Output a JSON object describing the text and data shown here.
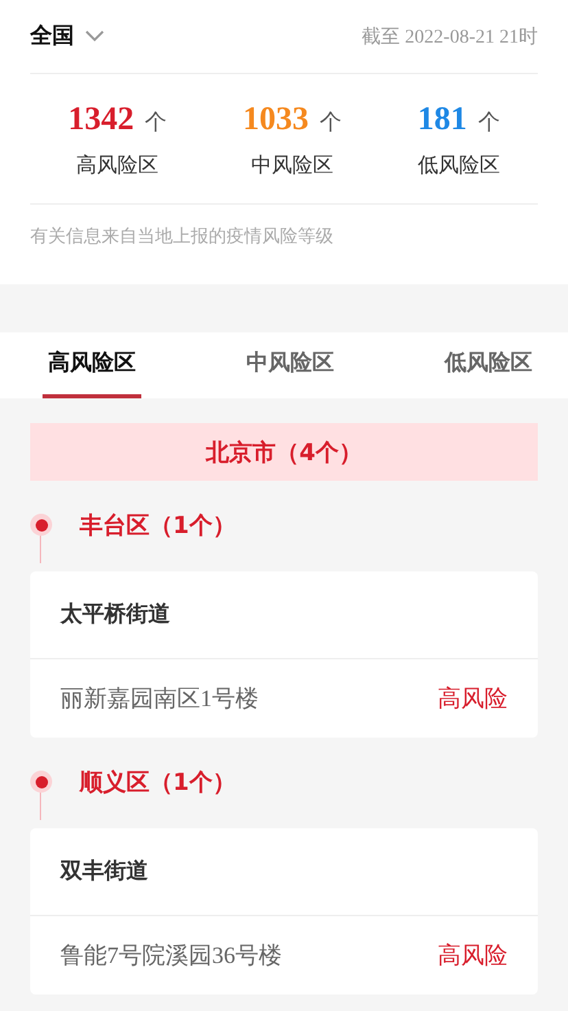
{
  "header": {
    "region": "全国",
    "updated": "截至 2022-08-21 21时"
  },
  "stats": [
    {
      "count": "1342",
      "unit": "个",
      "label": "高风险区",
      "color": "#d81e2c"
    },
    {
      "count": "1033",
      "unit": "个",
      "label": "中风险区",
      "color": "#f5891f"
    },
    {
      "count": "181",
      "unit": "个",
      "label": "低风险区",
      "color": "#1e88e5"
    }
  ],
  "note": "有关信息来自当地上报的疫情风险等级",
  "tabs": [
    {
      "label": "高风险区",
      "selected": true
    },
    {
      "label": "中风险区",
      "selected": false
    },
    {
      "label": "低风险区",
      "selected": false
    }
  ],
  "city": "北京市（4个）",
  "districts": [
    {
      "name": "丰台区（1个）",
      "streets": [
        {
          "name": "太平桥街道",
          "places": [
            {
              "name": "丽新嘉园南区1号楼",
              "risk": "高风险"
            }
          ]
        }
      ]
    },
    {
      "name": "顺义区（1个）",
      "streets": [
        {
          "name": "双丰街道",
          "places": [
            {
              "name": "鲁能7号院溪园36号楼",
              "risk": "高风险"
            }
          ]
        }
      ]
    }
  ]
}
